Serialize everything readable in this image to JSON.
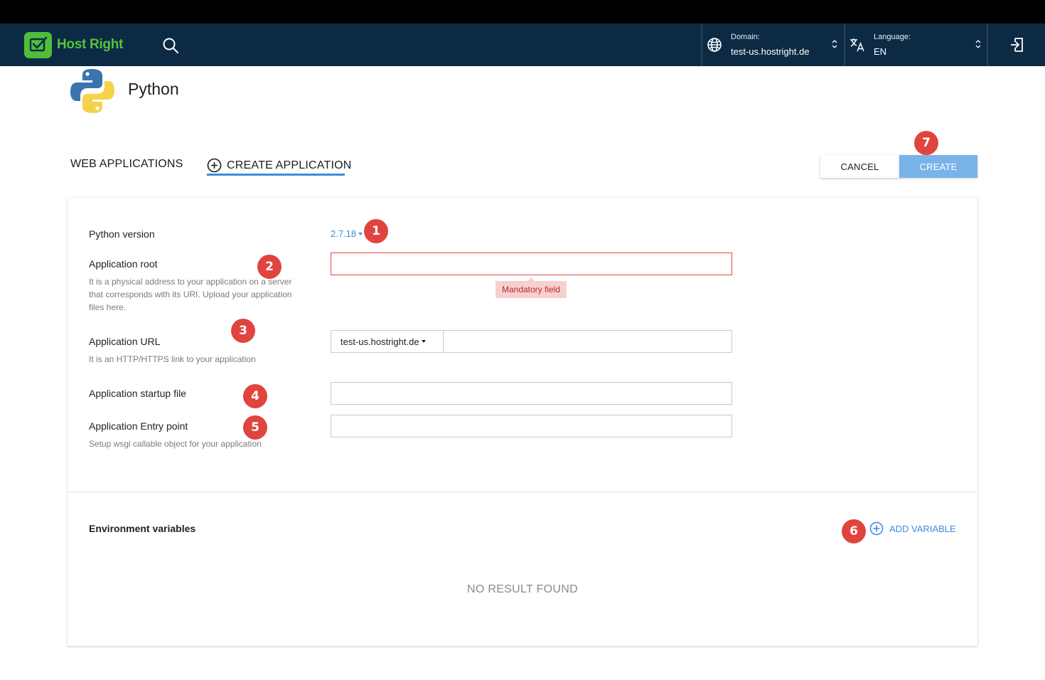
{
  "header": {
    "brand": "Host Right",
    "domain_label": "Domain:",
    "domain_value": "test-us.hostright.de",
    "language_label": "Language:",
    "language_value": "EN"
  },
  "page": {
    "title": "Python"
  },
  "tabs": [
    {
      "label": "WEB APPLICATIONS",
      "active": false
    },
    {
      "label": "CREATE APPLICATION",
      "active": true
    }
  ],
  "actions": {
    "cancel": "CANCEL",
    "create": "CREATE"
  },
  "form": {
    "python_version": {
      "label": "Python version",
      "value": "2.7.18"
    },
    "app_root": {
      "label": "Application root",
      "help": "It is a physical address to your application on a server that corresponds with its URI. Upload your application files here.",
      "value": "",
      "error": "Mandatory field"
    },
    "app_url": {
      "label": "Application URL",
      "help": "It is an HTTP/HTTPS link to your application",
      "domain": "test-us.hostright.de",
      "path": ""
    },
    "startup_file": {
      "label": "Application startup file",
      "value": ""
    },
    "entry_point": {
      "label": "Application Entry point",
      "help": "Setup wsgi callable object for your application",
      "value": ""
    }
  },
  "env": {
    "title": "Environment variables",
    "add_label": "ADD VARIABLE",
    "empty": "NO RESULT FOUND"
  },
  "badges": [
    "1",
    "2",
    "3",
    "4",
    "5",
    "6",
    "7"
  ],
  "colors": {
    "navbar": "#0c2a44",
    "accent": "#3d8ddb",
    "brand": "#57c23f",
    "create_button": "#7ab3ea",
    "error": "#e04b4b",
    "badge": "#e0443f"
  }
}
